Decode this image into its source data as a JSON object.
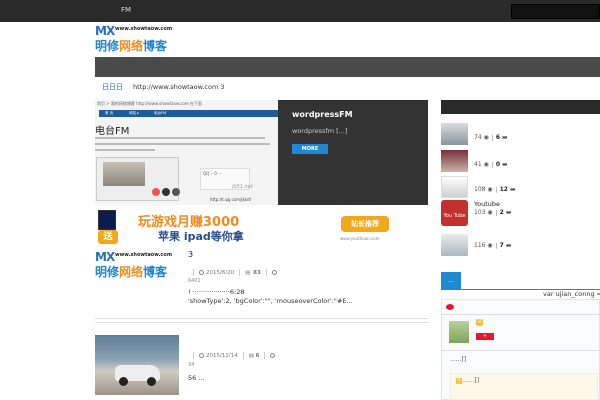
{
  "topbar": {
    "nav_fm": "FM"
  },
  "logo": {
    "mx": "MX",
    "domain": "www.showtaow.com",
    "cn_part1": "明修",
    "cn_part2": "网络",
    "cn_part3": "博客"
  },
  "url_bar": {
    "prefix": "日日日",
    "text": "http://www.showtaow.com 3"
  },
  "slider": {
    "crumbs": "首页 > 我的网络博客 http://www.showtaow.com 在下面",
    "inner_nav": [
      "首 页",
      "网站 ▸",
      "电台FM"
    ],
    "radio_title": "电台FM",
    "qq_url": "http://t.qq.com/jkkdl",
    "watermark": "jb51.net",
    "overlay_title": "wordpressFM",
    "overlay_desc": "wordpressfm [...]",
    "more_label": "MORE"
  },
  "ad": {
    "song": "送",
    "main_line1": "玩游戏月赚3000",
    "main_line2": "苹果 ipad等你拿",
    "recommend": "站长推荐",
    "url": "www.youthuan.com"
  },
  "posts": [
    {
      "title": "3",
      "date": "2015/6/20",
      "comments": "83",
      "views": "6401",
      "excerpt_line1": "! ··················6:28",
      "excerpt_line2": "'showType':2, 'bgColor':\"\", 'mouseoverColor':\"#E..."
    },
    {
      "title": "",
      "date": "2015/12/14",
      "comments": "6",
      "views": "34",
      "excerpt": "56 ...",
      "excerpt_more": "..."
    }
  ],
  "sidebar": {
    "items": [
      {
        "title": "",
        "views": "74",
        "comments": "6"
      },
      {
        "title": "",
        "views": "41",
        "comments": "0"
      },
      {
        "title": "",
        "views": "108",
        "comments": "12"
      },
      {
        "title": "Youtube",
        "views": "103",
        "comments": "2",
        "thumb_label": "You Tube"
      },
      {
        "title": "",
        "views": "116",
        "comments": "7"
      }
    ],
    "widget_tab": "...",
    "widget_user": "var ujian_conng ="
  },
  "weibo": {
    "v_badge": "V",
    "follow": "+",
    "dots1": "......[]",
    "v_badge2": "V",
    "dots2": "......[]"
  }
}
